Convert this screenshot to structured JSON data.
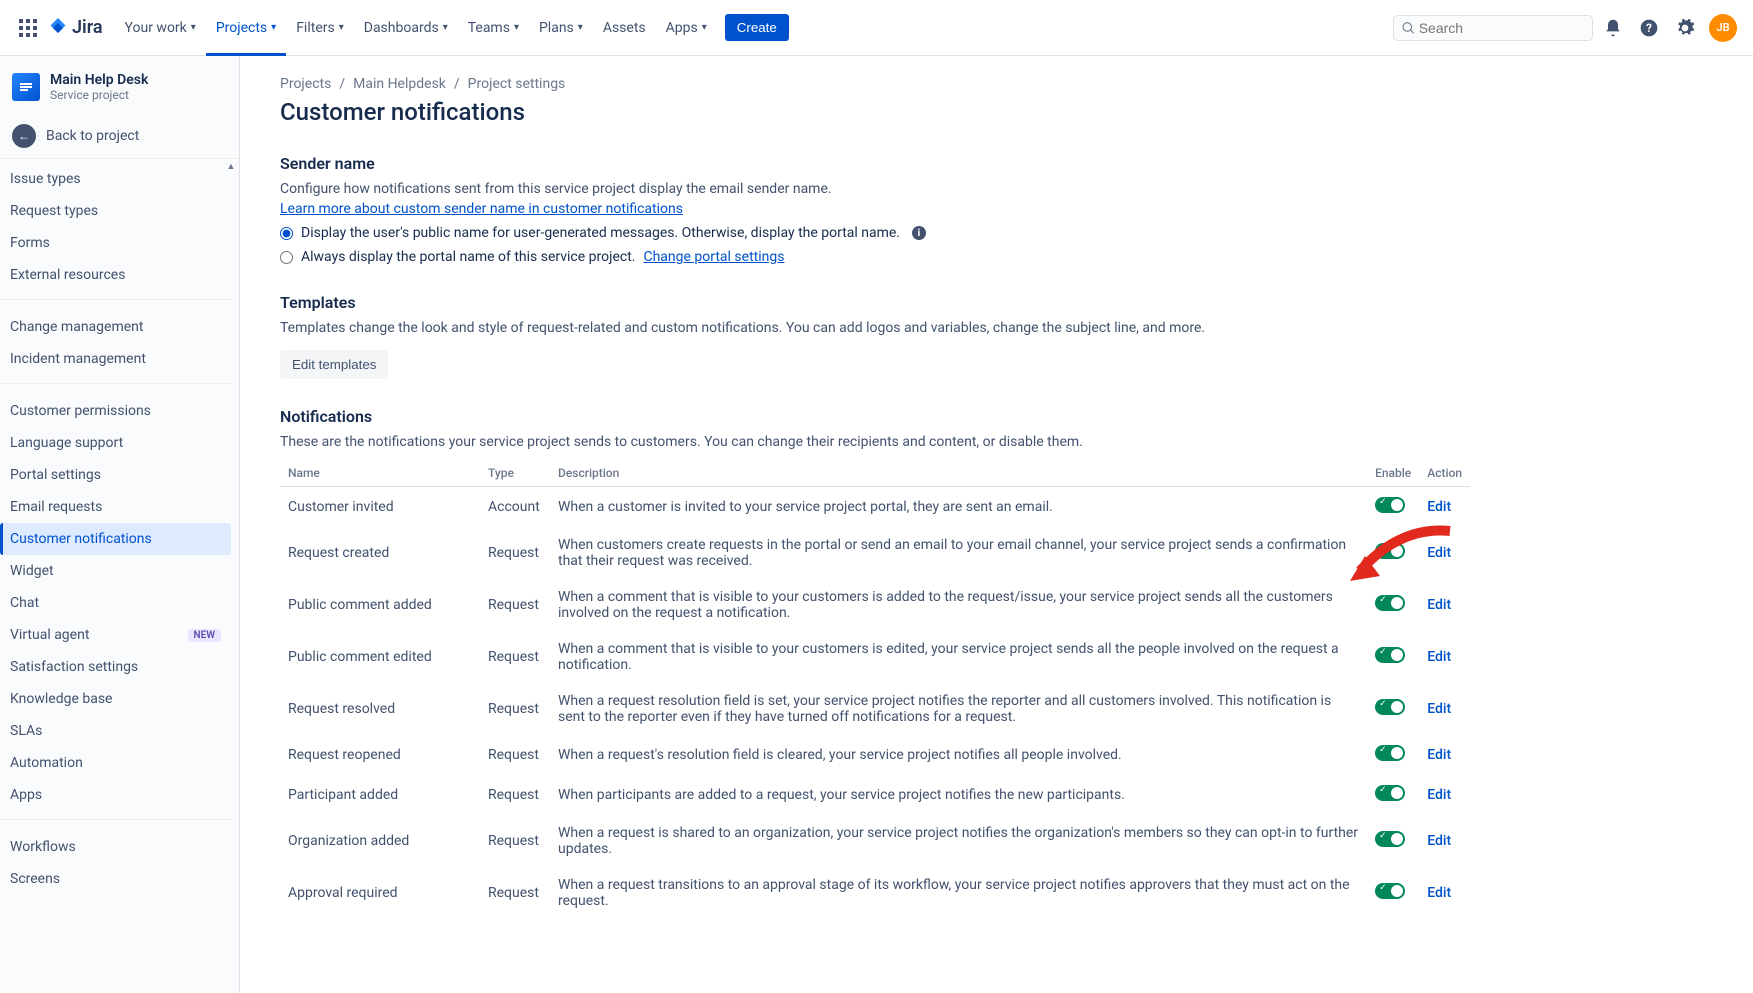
{
  "nav": {
    "logo": "Jira",
    "links": [
      "Your work",
      "Projects",
      "Filters",
      "Dashboards",
      "Teams",
      "Plans",
      "Assets",
      "Apps"
    ],
    "active_index": 1,
    "no_chevron": [
      6
    ],
    "create": "Create",
    "search_placeholder": "Search",
    "avatar": "JB"
  },
  "sidebar": {
    "project_name": "Main Help Desk",
    "project_type": "Service project",
    "back": "Back to project",
    "items": [
      {
        "label": "Issue types",
        "group": 0
      },
      {
        "label": "Request types",
        "group": 0
      },
      {
        "label": "Forms",
        "group": 0
      },
      {
        "label": "External resources",
        "group": 0
      },
      {
        "label": "Change management",
        "group": 1
      },
      {
        "label": "Incident management",
        "group": 1
      },
      {
        "label": "Customer permissions",
        "group": 2
      },
      {
        "label": "Language support",
        "group": 2
      },
      {
        "label": "Portal settings",
        "group": 2
      },
      {
        "label": "Email requests",
        "group": 2
      },
      {
        "label": "Customer notifications",
        "group": 2,
        "selected": true
      },
      {
        "label": "Widget",
        "group": 2
      },
      {
        "label": "Chat",
        "group": 2
      },
      {
        "label": "Virtual agent",
        "group": 2,
        "badge": "NEW"
      },
      {
        "label": "Satisfaction settings",
        "group": 2
      },
      {
        "label": "Knowledge base",
        "group": 2
      },
      {
        "label": "SLAs",
        "group": 2
      },
      {
        "label": "Automation",
        "group": 2
      },
      {
        "label": "Apps",
        "group": 2
      },
      {
        "label": "Workflows",
        "group": 3
      },
      {
        "label": "Screens",
        "group": 3
      }
    ]
  },
  "breadcrumb": [
    "Projects",
    "Main Helpdesk",
    "Project settings"
  ],
  "page_title": "Customer notifications",
  "sender": {
    "heading": "Sender name",
    "desc": "Configure how notifications sent from this service project display the email sender name.",
    "learn_link": "Learn more about custom sender name in customer notifications",
    "opt1": "Display the user's public name for user-generated messages. Otherwise, display the portal name.",
    "opt2_prefix": "Always display the portal name of this service project. ",
    "opt2_link": "Change portal settings"
  },
  "templates": {
    "heading": "Templates",
    "desc": "Templates change the look and style of request-related and custom notifications. You can add logos and variables, change the subject line, and more.",
    "btn": "Edit templates"
  },
  "notifications": {
    "heading": "Notifications",
    "desc": "These are the notifications your service project sends to customers. You can change their recipients and content, or disable them.",
    "cols": {
      "name": "Name",
      "type": "Type",
      "desc": "Description",
      "enable": "Enable",
      "action": "Action"
    },
    "edit": "Edit",
    "rows": [
      {
        "name": "Customer invited",
        "type": "Account",
        "desc": "When a customer is invited to your service project portal, they are sent an email."
      },
      {
        "name": "Request created",
        "type": "Request",
        "desc": "When customers create requests in the portal or send an email to your email channel, your service project sends a confirmation that their request was received."
      },
      {
        "name": "Public comment added",
        "type": "Request",
        "desc": "When a comment that is visible to your customers is added to the request/issue, your service project sends all the customers involved on the request a notification."
      },
      {
        "name": "Public comment edited",
        "type": "Request",
        "desc": "When a comment that is visible to your customers is edited, your service project sends all the people involved on the request a notification."
      },
      {
        "name": "Request resolved",
        "type": "Request",
        "desc": "When a request resolution field is set, your service project notifies the reporter and all customers involved. This notification is sent to the reporter even if they have turned off notifications for a request."
      },
      {
        "name": "Request reopened",
        "type": "Request",
        "desc": "When a request's resolution field is cleared, your service project notifies all people involved."
      },
      {
        "name": "Participant added",
        "type": "Request",
        "desc": "When participants are added to a request, your service project notifies the new participants."
      },
      {
        "name": "Organization added",
        "type": "Request",
        "desc": "When a request is shared to an organization, your service project notifies the organization's members so they can opt-in to further updates."
      },
      {
        "name": "Approval required",
        "type": "Request",
        "desc": "When a request transitions to an approval stage of its workflow, your service project notifies approvers that they must act on the request."
      }
    ]
  }
}
